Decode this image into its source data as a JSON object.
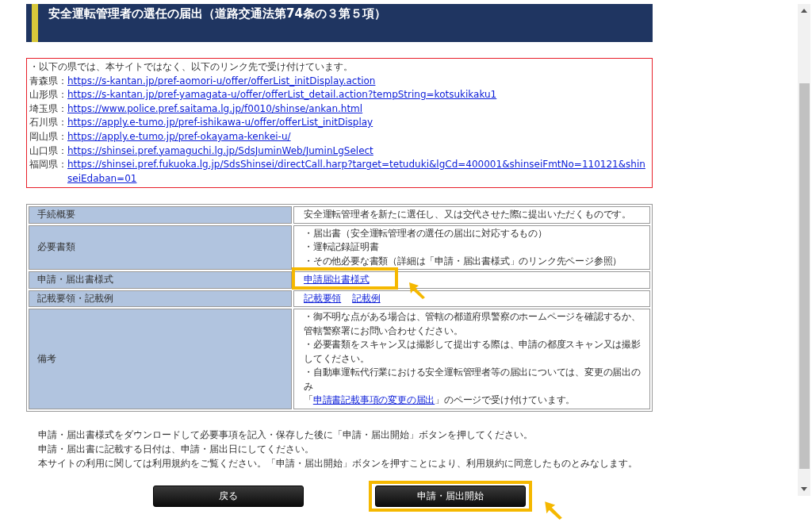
{
  "header": {
    "title": "安全運転管理者の選任の届出（道路交通法第74条の３第５項）"
  },
  "notice": {
    "intro": "・以下の県では、本サイトではなく、以下のリンク先で受け付けています。",
    "links": [
      {
        "prefecture": "青森県：",
        "url": "https://s-kantan.jp/pref-aomori-u/offer/offerList_initDisplay.action"
      },
      {
        "prefecture": "山形県：",
        "url": "https://s-kantan.jp/pref-yamagata-u/offer/offerList_detail.action?tempString=kotsukikaku1"
      },
      {
        "prefecture": "埼玉県：",
        "url": "https://www.police.pref.saitama.lg.jp/f0010/shinse/ankan.html"
      },
      {
        "prefecture": "石川県：",
        "url": "https://apply.e-tumo.jp/pref-ishikawa-u/offer/offerList_initDisplay"
      },
      {
        "prefecture": "岡山県：",
        "url": "https://apply.e-tumo.jp/pref-okayama-kenkei-u/"
      },
      {
        "prefecture": "山口県：",
        "url": "https://shinsei.pref.yamaguchi.lg.jp/SdsJuminWeb/JuminLgSelect"
      },
      {
        "prefecture": "福岡県：",
        "url": "https://shinsei.pref.fukuoka.lg.jp/SdsShinsei/directCall.harp?target=tetuduki&lgCd=400001&shinseiFmtNo=110121&shinseiEdaban=01"
      }
    ]
  },
  "table": {
    "rows": [
      {
        "label": "手続概要",
        "lines": [
          [
            {
              "kind": "text",
              "text": "安全運転管理者を新たに選任し、又は交代させた際に提出いただくものです。"
            }
          ]
        ]
      },
      {
        "label": "必要書類",
        "lines": [
          [
            {
              "kind": "text",
              "text": "・届出書（安全運転管理者の選任の届出に対応するもの）"
            }
          ],
          [
            {
              "kind": "text",
              "text": "・運転記録証明書"
            }
          ],
          [
            {
              "kind": "text",
              "text": "・その他必要な書類（詳細は「申請・届出書様式」のリンク先ページ参照）"
            }
          ]
        ]
      },
      {
        "label": "申請・届出書様式",
        "lines": [
          [
            {
              "kind": "link",
              "text": "申請届出書様式",
              "highlighted": true
            }
          ]
        ]
      },
      {
        "label": "記載要領・記載例",
        "lines": [
          [
            {
              "kind": "link",
              "text": "記載要領",
              "highlighted": false
            },
            {
              "kind": "link",
              "text": "記載例",
              "highlighted": false
            }
          ]
        ]
      },
      {
        "label": "備考",
        "lines": [
          [
            {
              "kind": "text",
              "text": "・御不明な点がある場合は、管轄の都道府県警察のホームページを確認するか、管轄警察署にお問い合わせください。"
            }
          ],
          [
            {
              "kind": "text",
              "text": "・必要書類をスキャン又は撮影して提出する際は、申請の都度スキャン又は撮影してください。"
            }
          ],
          [
            {
              "kind": "text",
              "text": "・自動車運転代行業における安全運転管理者等の届出については、変更の届出のみ"
            }
          ],
          [
            {
              "kind": "text",
              "text": "「"
            },
            {
              "kind": "link",
              "text": "申請書記載事項の変更の届出",
              "highlighted": false
            },
            {
              "kind": "text",
              "text": "」のページで受け付けています。"
            }
          ]
        ]
      }
    ]
  },
  "instructions": [
    "申請・届出書様式をダウンロードして必要事項を記入・保存した後に「申請・届出開始」ボタンを押してください。",
    "申請・届出書に記載する日付は、申請・届出日にしてください。",
    "本サイトの利用に関しては利用規約をご覧ください。「申請・届出開始」ボタンを押すことにより、利用規約に同意したものとみなします。"
  ],
  "buttons": [
    {
      "label": "戻る",
      "highlighted": false
    },
    {
      "label": "申請・届出開始",
      "highlighted": true
    }
  ]
}
